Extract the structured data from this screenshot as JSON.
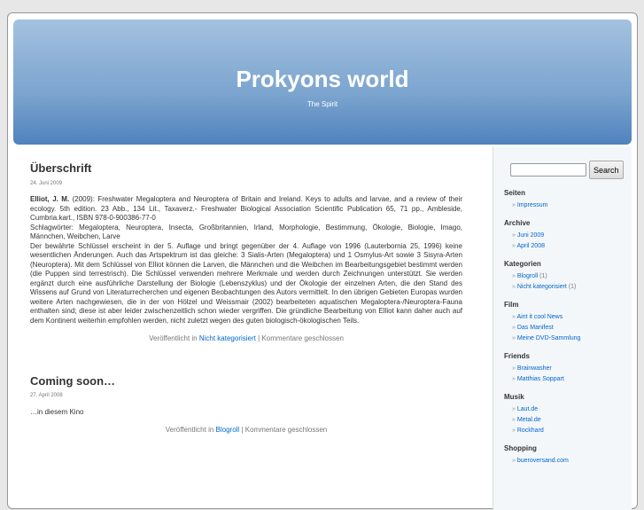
{
  "header": {
    "title": "Prokyons world",
    "description": "The Spirit"
  },
  "posts": [
    {
      "title": "Überschrift",
      "date": "24. Juni 2009",
      "author": "Elliot, J. M.",
      "body1": " (2009): Freshwater Megaloptera and Neuroptera of Britain and Ireland. Keys to adults and larvae, and a review of their ecology. 5th edition. 23 Abb., 134 Lit., Taxaverz.- Freshwater Biological Association Scientific Publication 65, 71 pp., Ambleside, Cumbria.kart., ISBN 978-0-900386-77-0",
      "keywords": "Schlagwörter: Megaloptera, Neuroptera, Insecta, Großbritannien, Irland, Morphologie, Bestimmung, Ökologie, Biologie, Imago, Männchen, Weibchen, Larve",
      "body2": "Der bewährte Schlüssel erscheint in der 5. Auflage und bringt gegenüber der 4. Auflage von 1996 (Lauterbornia 25, 1996) keine wesentlichen Änderungen. Auch das Artspektrum ist das gleiche: 3 Sialis-Arten (Megaloptera) und 1 Osmylus-Art sowie 3 Sisyra-Arten (Neuroptera). Mit dem Schlüssel von Elliot können die Larven, die Männchen und die Weibchen im Bearbeitungsgebiet bestimmt werden (die Puppen sind terrestrisch). Die Schlüssel verwenden mehrere Merkmale und werden durch Zeichnungen unterstützt. Sie werden ergänzt durch eine ausführliche Darstellung der Biologie (Lebenszyklus) und der Ökologie der einzelnen Arten, die den Stand des Wissens auf Grund von Literaturrecherchen und eigenen Beobachtungen des Autors vermittelt. In den übrigen Gebieten Europas wurden weitere Arten nachgewiesen, die in der von Hölzel und Weissmair (2002) bearbeiteten aquatischen Megaloptera-/Neuroptera-Fauna enthalten sind; diese ist aber leider zwischenzeitlich schon wieder vergriffen. Die gründliche Bearbeitung von Elliot kann daher auch auf dem Kontinent weiterhin empfohlen werden, nicht zuletzt wegen des guten biologisch-ökologischen Teils.",
      "meta_prefix": "Veröffentlicht in ",
      "category": "Nicht kategorisiert",
      "meta_suffix": " | Kommentare geschlossen"
    },
    {
      "title": "Coming soon…",
      "date": "27. April 2008",
      "body": "…in diesem Kino",
      "meta_prefix": "Veröffentlicht in ",
      "category": "Blogroll",
      "meta_suffix": " | Kommentare geschlossen"
    }
  ],
  "sidebar": {
    "search_button": "Search",
    "search_value": "",
    "widgets": [
      {
        "title": "Seiten",
        "items": [
          {
            "label": "Impressum"
          }
        ]
      },
      {
        "title": "Archive",
        "items": [
          {
            "label": "Juni 2009"
          },
          {
            "label": "April 2008"
          }
        ]
      },
      {
        "title": "Kategorien",
        "items": [
          {
            "label": "Blogroll",
            "count": "(1)"
          },
          {
            "label": "Nicht kategorisiert",
            "count": "(1)"
          }
        ]
      },
      {
        "title": "Film",
        "items": [
          {
            "label": "Aint it cool News"
          },
          {
            "label": "Das Manifest"
          },
          {
            "label": "Meine DVD-Sammlung"
          }
        ]
      },
      {
        "title": "Friends",
        "items": [
          {
            "label": "Brainwasher"
          },
          {
            "label": "Matthias Soppart"
          }
        ]
      },
      {
        "title": "Musik",
        "items": [
          {
            "label": "Laut.de"
          },
          {
            "label": "Metal.de"
          },
          {
            "label": "Rockhard"
          }
        ]
      },
      {
        "title": "Shopping",
        "items": [
          {
            "label": "bueroversand.com"
          }
        ]
      }
    ]
  }
}
